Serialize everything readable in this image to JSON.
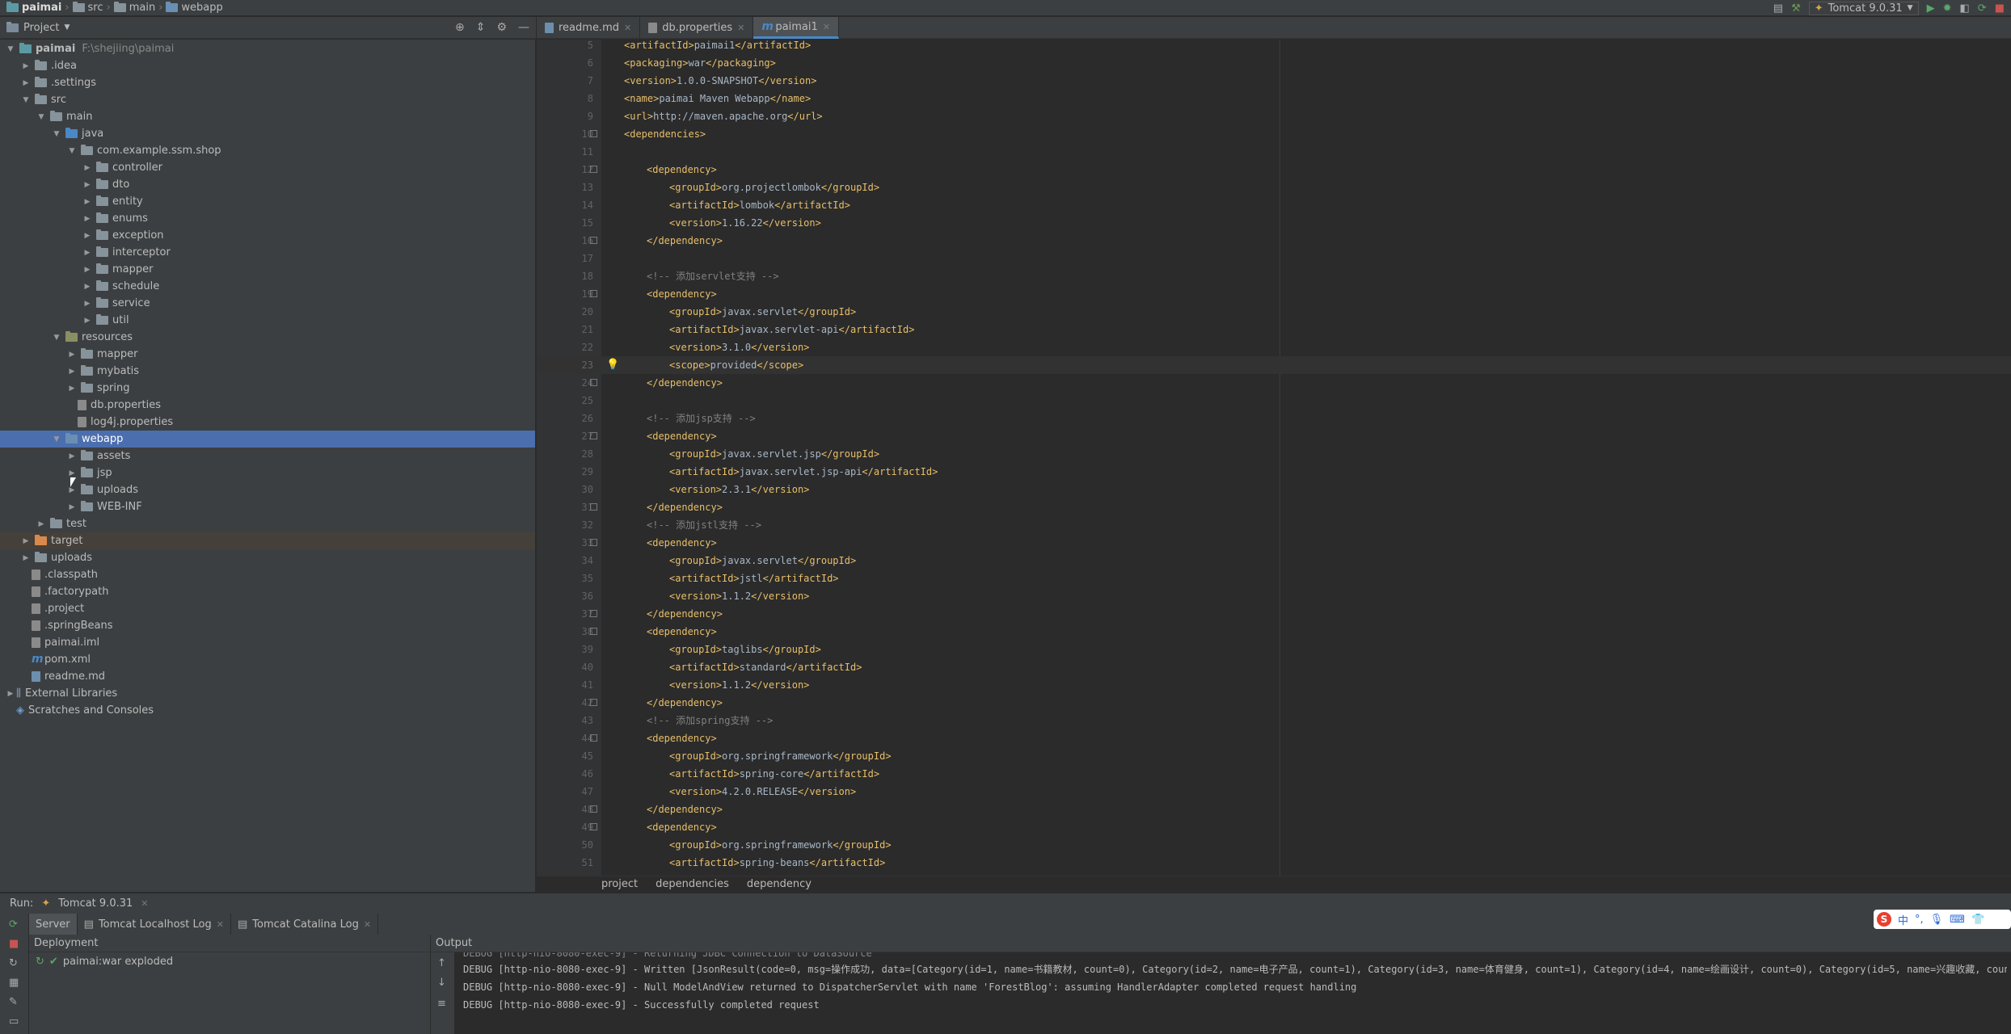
{
  "titlebar": {
    "project": "paimai",
    "crumbs": [
      "src",
      "main",
      "webapp"
    ],
    "run_config": "Tomcat 9.0.31"
  },
  "project_panel": {
    "title": "Project",
    "tree": [
      {
        "label": "paimai",
        "path": "F:\\shejiing\\paimai",
        "indent": 0,
        "arrow": "▼",
        "icon": "folder-teal",
        "bold": true
      },
      {
        "label": ".idea",
        "indent": 1,
        "arrow": "▶",
        "icon": "folder"
      },
      {
        "label": ".settings",
        "indent": 1,
        "arrow": "▶",
        "icon": "folder"
      },
      {
        "label": "src",
        "indent": 1,
        "arrow": "▼",
        "icon": "folder"
      },
      {
        "label": "main",
        "indent": 2,
        "arrow": "▼",
        "icon": "folder"
      },
      {
        "label": "java",
        "indent": 3,
        "arrow": "▼",
        "icon": "folder-blue"
      },
      {
        "label": "com.example.ssm.shop",
        "indent": 4,
        "arrow": "▼",
        "icon": "folder"
      },
      {
        "label": "controller",
        "indent": 5,
        "arrow": "▶",
        "icon": "folder"
      },
      {
        "label": "dto",
        "indent": 5,
        "arrow": "▶",
        "icon": "folder"
      },
      {
        "label": "entity",
        "indent": 5,
        "arrow": "▶",
        "icon": "folder"
      },
      {
        "label": "enums",
        "indent": 5,
        "arrow": "▶",
        "icon": "folder"
      },
      {
        "label": "exception",
        "indent": 5,
        "arrow": "▶",
        "icon": "folder"
      },
      {
        "label": "interceptor",
        "indent": 5,
        "arrow": "▶",
        "icon": "folder"
      },
      {
        "label": "mapper",
        "indent": 5,
        "arrow": "▶",
        "icon": "folder"
      },
      {
        "label": "schedule",
        "indent": 5,
        "arrow": "▶",
        "icon": "folder"
      },
      {
        "label": "service",
        "indent": 5,
        "arrow": "▶",
        "icon": "folder"
      },
      {
        "label": "util",
        "indent": 5,
        "arrow": "▶",
        "icon": "folder"
      },
      {
        "label": "resources",
        "indent": 3,
        "arrow": "▼",
        "icon": "folder-res"
      },
      {
        "label": "mapper",
        "indent": 4,
        "arrow": "▶",
        "icon": "folder"
      },
      {
        "label": "mybatis",
        "indent": 4,
        "arrow": "▶",
        "icon": "folder"
      },
      {
        "label": "spring",
        "indent": 4,
        "arrow": "▶",
        "icon": "folder"
      },
      {
        "label": "db.properties",
        "indent": 4,
        "arrow": "",
        "icon": "file-cfg"
      },
      {
        "label": "log4j.properties",
        "indent": 4,
        "arrow": "",
        "icon": "file-cfg"
      },
      {
        "label": "webapp",
        "indent": 3,
        "arrow": "▼",
        "icon": "folder-web",
        "selected": true
      },
      {
        "label": "assets",
        "indent": 4,
        "arrow": "▶",
        "icon": "folder"
      },
      {
        "label": "jsp",
        "indent": 4,
        "arrow": "▶",
        "icon": "folder"
      },
      {
        "label": "uploads",
        "indent": 4,
        "arrow": "▶",
        "icon": "folder"
      },
      {
        "label": "WEB-INF",
        "indent": 4,
        "arrow": "▶",
        "icon": "folder"
      },
      {
        "label": "test",
        "indent": 2,
        "arrow": "▶",
        "icon": "folder"
      },
      {
        "label": "target",
        "indent": 1,
        "arrow": "▶",
        "icon": "folder-orange",
        "highlight": true
      },
      {
        "label": "uploads",
        "indent": 1,
        "arrow": "▶",
        "icon": "folder"
      },
      {
        "label": ".classpath",
        "indent": 1,
        "arrow": "",
        "icon": "file-cfg"
      },
      {
        "label": ".factorypath",
        "indent": 1,
        "arrow": "",
        "icon": "file-cfg"
      },
      {
        "label": ".project",
        "indent": 1,
        "arrow": "",
        "icon": "file-cfg"
      },
      {
        "label": ".springBeans",
        "indent": 1,
        "arrow": "",
        "icon": "file-cfg"
      },
      {
        "label": "paimai.iml",
        "indent": 1,
        "arrow": "",
        "icon": "file-cfg"
      },
      {
        "label": "pom.xml",
        "indent": 1,
        "arrow": "",
        "icon": "file-m"
      },
      {
        "label": "readme.md",
        "indent": 1,
        "arrow": "",
        "icon": "file-md"
      },
      {
        "label": "External Libraries",
        "indent": 0,
        "arrow": "▶",
        "icon": "lib"
      },
      {
        "label": "Scratches and Consoles",
        "indent": 0,
        "arrow": "",
        "icon": "scratch"
      }
    ]
  },
  "editor_tabs": [
    {
      "label": "readme.md",
      "active": false
    },
    {
      "label": "db.properties",
      "active": false
    },
    {
      "label": "paimai1",
      "active": true
    }
  ],
  "editor_lines": [
    {
      "n": "5",
      "indent": 1,
      "parts": [
        [
          "t",
          "<artifactId>"
        ],
        [
          "v",
          "paimai1"
        ],
        [
          "t",
          "</artifactId>"
        ]
      ]
    },
    {
      "n": "6",
      "indent": 1,
      "parts": [
        [
          "t",
          "<packaging>"
        ],
        [
          "v",
          "war"
        ],
        [
          "t",
          "</packaging>"
        ]
      ]
    },
    {
      "n": "7",
      "indent": 1,
      "parts": [
        [
          "t",
          "<version>"
        ],
        [
          "v",
          "1.0.0-SNAPSHOT"
        ],
        [
          "t",
          "</version>"
        ]
      ]
    },
    {
      "n": "8",
      "indent": 1,
      "parts": [
        [
          "t",
          "<name>"
        ],
        [
          "v",
          "paimai Maven Webapp"
        ],
        [
          "t",
          "</name>"
        ]
      ]
    },
    {
      "n": "9",
      "indent": 1,
      "parts": [
        [
          "t",
          "<url>"
        ],
        [
          "v",
          "http://maven.apache.org"
        ],
        [
          "t",
          "</url>"
        ]
      ]
    },
    {
      "n": "10",
      "indent": 1,
      "fold": true,
      "parts": [
        [
          "t",
          "<dependencies>"
        ]
      ]
    },
    {
      "n": "11",
      "indent": 1,
      "parts": []
    },
    {
      "n": "12",
      "indent": 2,
      "fold": true,
      "parts": [
        [
          "t",
          "<dependency>"
        ]
      ]
    },
    {
      "n": "13",
      "indent": 3,
      "parts": [
        [
          "t",
          "<groupId>"
        ],
        [
          "v",
          "org.projectlombok"
        ],
        [
          "t",
          "</groupId>"
        ]
      ]
    },
    {
      "n": "14",
      "indent": 3,
      "parts": [
        [
          "t",
          "<artifactId>"
        ],
        [
          "v",
          "lombok"
        ],
        [
          "t",
          "</artifactId>"
        ]
      ]
    },
    {
      "n": "15",
      "indent": 3,
      "parts": [
        [
          "t",
          "<version>"
        ],
        [
          "v",
          "1.16.22"
        ],
        [
          "t",
          "</version>"
        ]
      ]
    },
    {
      "n": "16",
      "indent": 2,
      "fold": true,
      "parts": [
        [
          "t",
          "</dependency>"
        ]
      ]
    },
    {
      "n": "17",
      "indent": 2,
      "parts": []
    },
    {
      "n": "18",
      "indent": 2,
      "parts": [
        [
          "c",
          "<!-- 添加servlet支持 -->"
        ]
      ]
    },
    {
      "n": "19",
      "indent": 2,
      "fold": true,
      "parts": [
        [
          "t",
          "<dependency>"
        ]
      ]
    },
    {
      "n": "20",
      "indent": 3,
      "parts": [
        [
          "t",
          "<groupId>"
        ],
        [
          "v",
          "javax.servlet"
        ],
        [
          "t",
          "</groupId>"
        ]
      ]
    },
    {
      "n": "21",
      "indent": 3,
      "parts": [
        [
          "t",
          "<artifactId>"
        ],
        [
          "v",
          "javax.servlet-api"
        ],
        [
          "t",
          "</artifactId>"
        ]
      ]
    },
    {
      "n": "22",
      "indent": 3,
      "parts": [
        [
          "t",
          "<version>"
        ],
        [
          "v",
          "3.1.0"
        ],
        [
          "t",
          "</version>"
        ]
      ]
    },
    {
      "n": "23",
      "indent": 3,
      "current": true,
      "bulb": true,
      "parts": [
        [
          "t",
          "<scope>"
        ],
        [
          "v",
          "provided"
        ],
        [
          "t",
          "</scope>"
        ]
      ]
    },
    {
      "n": "24",
      "indent": 2,
      "fold": true,
      "parts": [
        [
          "t",
          "</dependency>"
        ]
      ]
    },
    {
      "n": "25",
      "indent": 2,
      "parts": []
    },
    {
      "n": "26",
      "indent": 2,
      "parts": [
        [
          "c",
          "<!-- 添加jsp支持 -->"
        ]
      ]
    },
    {
      "n": "27",
      "indent": 2,
      "fold": true,
      "parts": [
        [
          "t",
          "<dependency>"
        ]
      ]
    },
    {
      "n": "28",
      "indent": 3,
      "parts": [
        [
          "t",
          "<groupId>"
        ],
        [
          "v",
          "javax.servlet.jsp"
        ],
        [
          "t",
          "</groupId>"
        ]
      ]
    },
    {
      "n": "29",
      "indent": 3,
      "parts": [
        [
          "t",
          "<artifactId>"
        ],
        [
          "v",
          "javax.servlet.jsp-api"
        ],
        [
          "t",
          "</artifactId>"
        ]
      ]
    },
    {
      "n": "30",
      "indent": 3,
      "parts": [
        [
          "t",
          "<version>"
        ],
        [
          "v",
          "2.3.1"
        ],
        [
          "t",
          "</version>"
        ]
      ]
    },
    {
      "n": "31",
      "indent": 2,
      "fold": true,
      "parts": [
        [
          "t",
          "</dependency>"
        ]
      ]
    },
    {
      "n": "32",
      "indent": 2,
      "parts": [
        [
          "c",
          "<!-- 添加jstl支持 -->"
        ]
      ]
    },
    {
      "n": "33",
      "indent": 2,
      "fold": true,
      "parts": [
        [
          "t",
          "<dependency>"
        ]
      ]
    },
    {
      "n": "34",
      "indent": 3,
      "parts": [
        [
          "t",
          "<groupId>"
        ],
        [
          "v",
          "javax.servlet"
        ],
        [
          "t",
          "</groupId>"
        ]
      ]
    },
    {
      "n": "35",
      "indent": 3,
      "parts": [
        [
          "t",
          "<artifactId>"
        ],
        [
          "v",
          "jstl"
        ],
        [
          "t",
          "</artifactId>"
        ]
      ]
    },
    {
      "n": "36",
      "indent": 3,
      "parts": [
        [
          "t",
          "<version>"
        ],
        [
          "v",
          "1.1.2"
        ],
        [
          "t",
          "</version>"
        ]
      ]
    },
    {
      "n": "37",
      "indent": 2,
      "fold": true,
      "parts": [
        [
          "t",
          "</dependency>"
        ]
      ]
    },
    {
      "n": "38",
      "indent": 2,
      "fold": true,
      "parts": [
        [
          "t",
          "<dependency>"
        ]
      ]
    },
    {
      "n": "39",
      "indent": 3,
      "parts": [
        [
          "t",
          "<groupId>"
        ],
        [
          "v",
          "taglibs"
        ],
        [
          "t",
          "</groupId>"
        ]
      ]
    },
    {
      "n": "40",
      "indent": 3,
      "parts": [
        [
          "t",
          "<artifactId>"
        ],
        [
          "v",
          "standard"
        ],
        [
          "t",
          "</artifactId>"
        ]
      ]
    },
    {
      "n": "41",
      "indent": 3,
      "parts": [
        [
          "t",
          "<version>"
        ],
        [
          "v",
          "1.1.2"
        ],
        [
          "t",
          "</version>"
        ]
      ]
    },
    {
      "n": "42",
      "indent": 2,
      "fold": true,
      "parts": [
        [
          "t",
          "</dependency>"
        ]
      ]
    },
    {
      "n": "43",
      "indent": 2,
      "parts": [
        [
          "c",
          "<!-- 添加spring支持 -->"
        ]
      ]
    },
    {
      "n": "44",
      "indent": 2,
      "fold": true,
      "parts": [
        [
          "t",
          "<dependency>"
        ]
      ]
    },
    {
      "n": "45",
      "indent": 3,
      "parts": [
        [
          "t",
          "<groupId>"
        ],
        [
          "v",
          "org.springframework"
        ],
        [
          "t",
          "</groupId>"
        ]
      ]
    },
    {
      "n": "46",
      "indent": 3,
      "parts": [
        [
          "t",
          "<artifactId>"
        ],
        [
          "v",
          "spring-core"
        ],
        [
          "t",
          "</artifactId>"
        ]
      ]
    },
    {
      "n": "47",
      "indent": 3,
      "parts": [
        [
          "t",
          "<version>"
        ],
        [
          "v",
          "4.2.0.RELEASE"
        ],
        [
          "t",
          "</version>"
        ]
      ]
    },
    {
      "n": "48",
      "indent": 2,
      "fold": true,
      "parts": [
        [
          "t",
          "</dependency>"
        ]
      ]
    },
    {
      "n": "49",
      "indent": 2,
      "fold": true,
      "parts": [
        [
          "t",
          "<dependency>"
        ]
      ]
    },
    {
      "n": "50",
      "indent": 3,
      "parts": [
        [
          "t",
          "<groupId>"
        ],
        [
          "v",
          "org.springframework"
        ],
        [
          "t",
          "</groupId>"
        ]
      ]
    },
    {
      "n": "51",
      "indent": 3,
      "parts": [
        [
          "t",
          "<artifactId>"
        ],
        [
          "v",
          "spring-beans"
        ],
        [
          "t",
          "</artifactId>"
        ]
      ]
    }
  ],
  "editor_breadcrumb": [
    "project",
    "dependencies",
    "dependency"
  ],
  "run_panel": {
    "label": "Run:",
    "config": "Tomcat 9.0.31",
    "tabs": [
      "Server",
      "Tomcat Localhost Log",
      "Tomcat Catalina Log"
    ],
    "deployment_header": "Deployment",
    "output_header": "Output",
    "deployment_item": "paimai:war exploded",
    "log_lines": [
      "DEBUG [http-nio-8080-exec-9] - Returning JDBC Connection to DataSource",
      "DEBUG [http-nio-8080-exec-9] - Written [JsonResult(code=0, msg=操作成功, data=[Category(id=1, name=书籍教材, count=0), Category(id=2, name=电子产品, count=1), Category(id=3, name=体育健身, count=1), Category(id=4, name=绘画设计, count=0), Category(id=5, name=兴趣收藏, coun",
      "DEBUG [http-nio-8080-exec-9] - Null ModelAndView returned to DispatcherServlet with name 'ForestBlog': assuming HandlerAdapter completed request handling",
      "DEBUG [http-nio-8080-exec-9] - Successfully completed request"
    ]
  },
  "ime": {
    "badge": "S",
    "mode": "中"
  }
}
